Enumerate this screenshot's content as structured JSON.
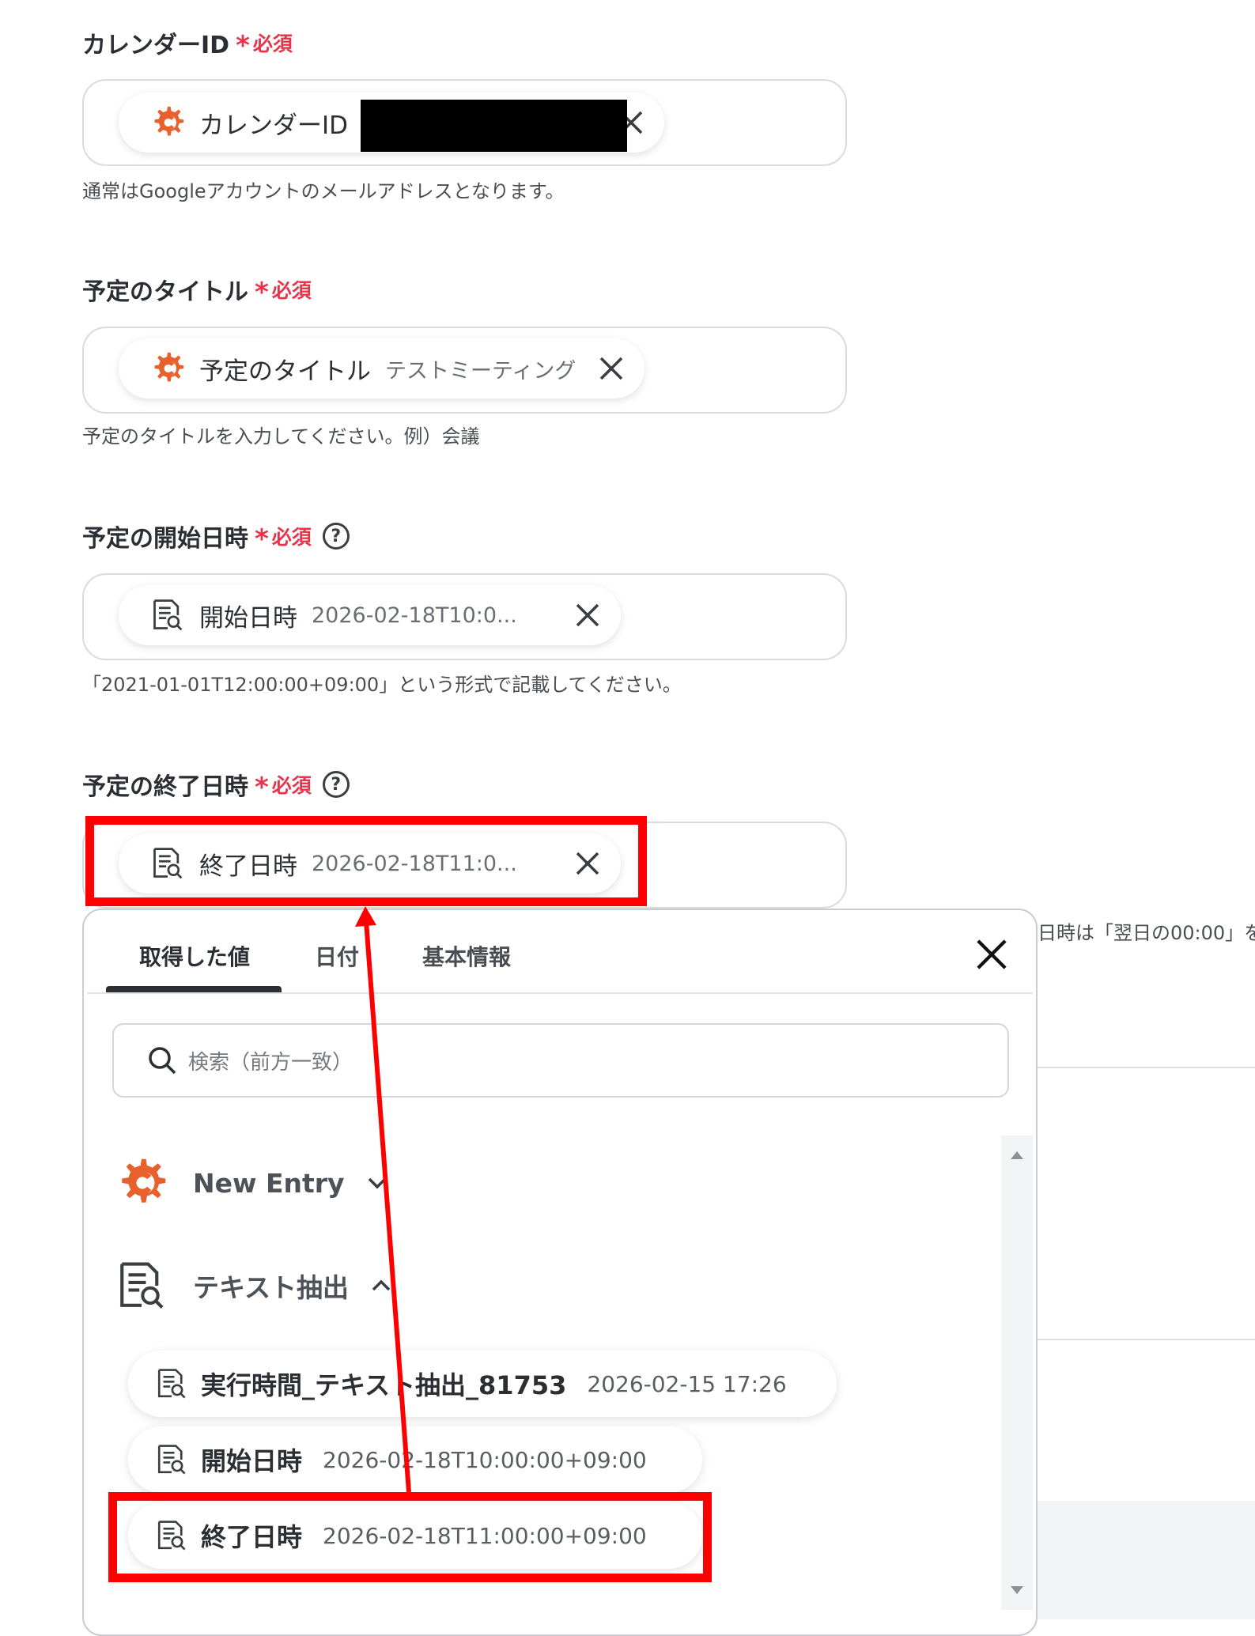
{
  "fields": [
    {
      "label": "カレンダーID",
      "required": "必須",
      "chip_name": "カレンダーID",
      "chip_value": "",
      "hint": "通常はGoogleアカウントのメールアドレスとなります。",
      "icon": "gear-app-icon"
    },
    {
      "label": "予定のタイトル",
      "required": "必須",
      "chip_name": "予定のタイトル",
      "chip_value": "テストミーティング",
      "hint": "予定のタイトルを入力してください。例）会議",
      "icon": "gear-app-icon"
    },
    {
      "label": "予定の開始日時",
      "required": "必須",
      "help": "?",
      "chip_name": "開始日時",
      "chip_value": "2026-02-18T10:0...",
      "hint": "「2021-01-01T12:00:00+09:00」という形式で記載してください。",
      "icon": "text-extract-icon"
    },
    {
      "label": "予定の終了日時",
      "required": "必須",
      "help": "?",
      "chip_name": "終了日時",
      "chip_value": "2026-02-18T11:0...",
      "hint": "日時は「翌日の00:00」を",
      "icon": "text-extract-icon"
    }
  ],
  "popup": {
    "tabs": [
      "取得した値",
      "日付",
      "基本情報"
    ],
    "active_tab": 0,
    "search_placeholder": "検索（前方一致）",
    "groups": [
      {
        "label": "New Entry",
        "icon": "gear-app-icon",
        "expanded": false
      },
      {
        "label": "テキスト抽出",
        "icon": "text-extract-icon",
        "expanded": true
      }
    ],
    "items": [
      {
        "name": "実行時間_テキスト抽出_81753",
        "value": "2026-02-15 17:26"
      },
      {
        "name": "開始日時",
        "value": "2026-02-18T10:00:00+09:00"
      },
      {
        "name": "終了日時",
        "value": "2026-02-18T11:00:00+09:00"
      }
    ]
  },
  "colors": {
    "required": "#e8334a",
    "app_icon": "#e8602c",
    "annotation": "#ff0000"
  }
}
